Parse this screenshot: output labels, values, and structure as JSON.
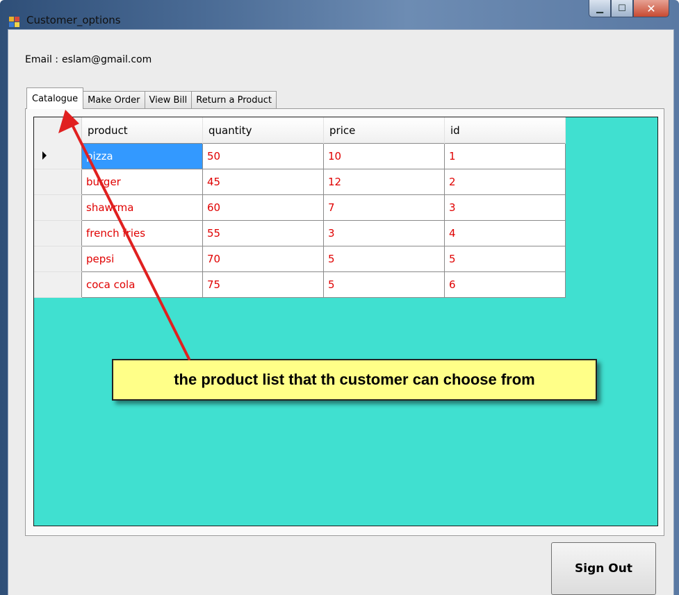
{
  "window": {
    "title": "Customer_options",
    "caption_buttons": [
      "minimize-icon",
      "maximize-icon",
      "close-icon"
    ]
  },
  "email": {
    "label": "Email :",
    "value": "eslam@gmail.com"
  },
  "tabs": [
    {
      "label": "Catalogue",
      "active": true
    },
    {
      "label": "Make Order",
      "active": false
    },
    {
      "label": "View Bill",
      "active": false
    },
    {
      "label": "Return a Product",
      "active": false
    }
  ],
  "grid": {
    "background": "#40e0d0",
    "cell_text_color": "#e00000",
    "columns": [
      "product",
      "quantity",
      "price",
      "id"
    ],
    "rows": [
      [
        "pizza",
        "50",
        "10",
        "1"
      ],
      [
        "burger",
        "45",
        "12",
        "2"
      ],
      [
        "shawrma",
        "60",
        "7",
        "3"
      ],
      [
        "french fries",
        "55",
        "3",
        "4"
      ],
      [
        "pepsi",
        "70",
        "5",
        "5"
      ],
      [
        "coca cola",
        "75",
        "5",
        "6"
      ]
    ],
    "selected_row": 0
  },
  "annotation": {
    "text": "the product list that th customer can choose from",
    "arrow_color": "#e02020"
  },
  "buttons": {
    "sign_out": "Sign Out"
  }
}
